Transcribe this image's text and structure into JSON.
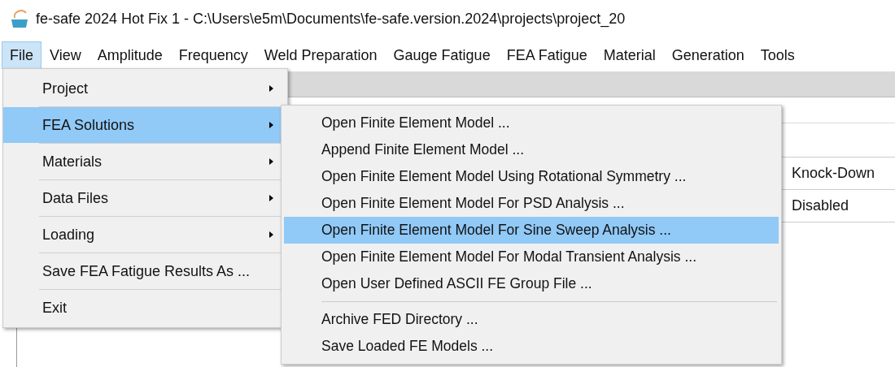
{
  "window": {
    "title": "fe-safe 2024 Hot Fix 1 - C:\\Users\\e5m\\Documents\\fe-safe.version.2024\\projects\\project_20"
  },
  "menubar": [
    {
      "label": "File",
      "selected": true
    },
    {
      "label": "View",
      "selected": false
    },
    {
      "label": "Amplitude",
      "selected": false
    },
    {
      "label": "Frequency",
      "selected": false
    },
    {
      "label": "Weld Preparation",
      "selected": false
    },
    {
      "label": "Gauge Fatigue",
      "selected": false
    },
    {
      "label": "FEA Fatigue",
      "selected": false
    },
    {
      "label": "Material",
      "selected": false
    },
    {
      "label": "Generation",
      "selected": false
    },
    {
      "label": "Tools",
      "selected": false
    }
  ],
  "file_menu": [
    {
      "label": "Project",
      "submenu": true,
      "selected": false
    },
    {
      "label": "FEA Solutions",
      "submenu": true,
      "selected": true
    },
    {
      "label": "Materials",
      "submenu": true,
      "selected": false
    },
    {
      "label": "Data Files",
      "submenu": true,
      "selected": false
    },
    {
      "label": "Loading",
      "submenu": true,
      "selected": false
    },
    {
      "label": "Save FEA Fatigue Results As ...",
      "submenu": false,
      "selected": false
    },
    {
      "label": "Exit",
      "submenu": false,
      "selected": false
    }
  ],
  "fea_solutions_menu": [
    {
      "kind": "item",
      "label": "Open Finite Element Model ...",
      "selected": false
    },
    {
      "kind": "item",
      "label": "Append Finite Element Model ...",
      "selected": false
    },
    {
      "kind": "item",
      "label": "Open Finite Element Model Using Rotational Symmetry ...",
      "selected": false
    },
    {
      "kind": "item",
      "label": "Open Finite Element Model For PSD Analysis ...",
      "selected": false
    },
    {
      "kind": "item",
      "label": "Open Finite Element Model For Sine Sweep Analysis ...",
      "selected": true
    },
    {
      "kind": "item",
      "label": "Open Finite Element Model For Modal Transient Analysis ...",
      "selected": false
    },
    {
      "kind": "item",
      "label": "Open User Defined ASCII FE Group File ...",
      "selected": false
    },
    {
      "kind": "separator"
    },
    {
      "kind": "item",
      "label": "Archive FED Directory ...",
      "selected": false
    },
    {
      "kind": "item",
      "label": "Save Loaded FE Models ...",
      "selected": false
    }
  ],
  "background_table": {
    "cells": [
      "Knock-Down",
      "Disabled"
    ]
  }
}
